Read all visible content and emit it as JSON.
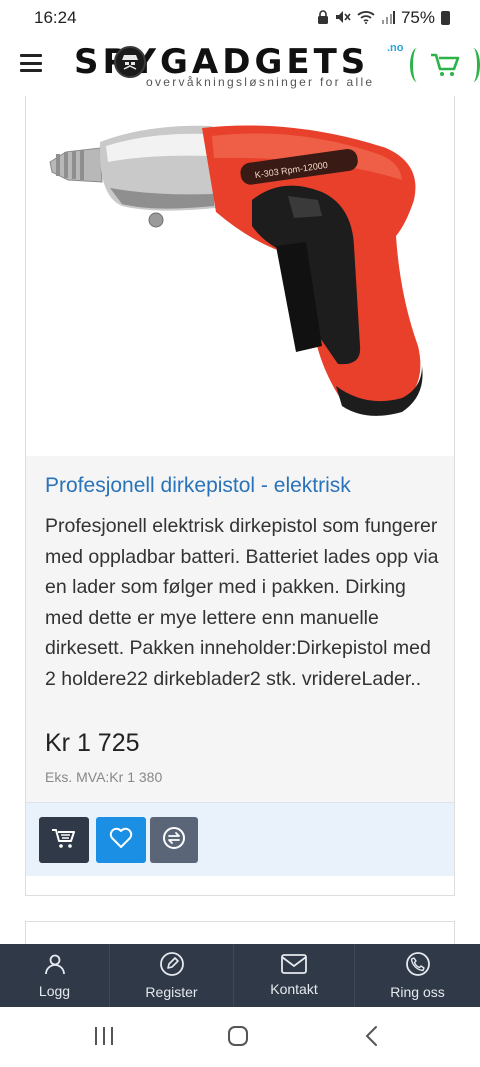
{
  "status": {
    "time": "16:24",
    "battery": "75%",
    "icons": [
      "lock-icon",
      "mute-icon",
      "wifi-icon",
      "signal-icon",
      "battery-icon"
    ]
  },
  "header": {
    "logo_text": "SPYGADGETS",
    "logo_no": ".no",
    "tagline": "overvåkningsløsninger for alle",
    "brand_green": "#2db34a"
  },
  "product": {
    "title": "Profesjonell dirkepistol - elektrisk",
    "description": "Profesjonell elektrisk dirkepistol som fungerer med oppladbar batteri. Batteriet lades opp via en lader som følger med i pakken. Dirking med dette er mye lettere enn manuelle dirkesett. Pakken inneholder:Dirkepistol med 2 holdere22 dirkeblader2 stk. vridereLader..",
    "price": "Kr 1 725",
    "price_ex": "Eks. MVA:Kr 1 380",
    "image_label": "K-303 Rpm-12000",
    "actions": [
      "cart-icon",
      "heart-icon",
      "compare-icon"
    ]
  },
  "bottom_nav": {
    "items": [
      {
        "label": "Logg",
        "icon": "user-icon"
      },
      {
        "label": "Register",
        "icon": "edit-icon"
      },
      {
        "label": "Kontakt",
        "icon": "mail-icon"
      },
      {
        "label": "Ring oss",
        "icon": "phone-icon"
      }
    ]
  },
  "colors": {
    "title_blue": "#2a73b8",
    "nav_bg": "#2f3947",
    "wishlist_blue": "#1a8fe3",
    "drill_red": "#e8402a"
  }
}
